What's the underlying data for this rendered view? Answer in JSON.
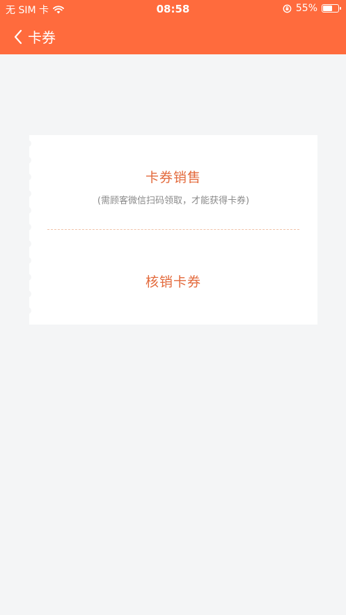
{
  "status_bar": {
    "carrier": "无 SIM 卡",
    "time": "08:58",
    "battery_percent_text": "55%",
    "battery_level": 0.55
  },
  "nav": {
    "title": "卡券",
    "back_icon": "chevron-left-icon"
  },
  "card": {
    "sell_title": "卡券销售",
    "sell_subtitle": "(需顾客微信扫码领取，才能获得卡券)",
    "verify_title": "核销卡券"
  },
  "colors": {
    "header_bg": "#ff6b3d",
    "accent_text": "#e36a3c",
    "page_bg": "#f4f5f6"
  }
}
